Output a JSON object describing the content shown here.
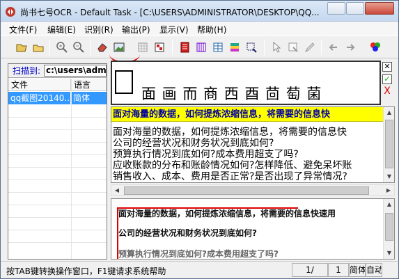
{
  "window": {
    "title": "尚书七号OCR - Default Task - [C:\\USERS\\ADMINISTRATOR\\DESKTOP\\QQ..."
  },
  "menu": [
    "文件(F)",
    "编辑(E)",
    "识别(R)",
    "输出(P)",
    "显示(V)",
    "帮助(H)"
  ],
  "toolbar": {
    "icons": [
      "open-folder-icon",
      "open-file-icon",
      "zoom-in-icon",
      "zoom-out-icon",
      "eraser-icon",
      "image-icon",
      "grid-icon",
      "layout-icon",
      "red-book-icon",
      "column-icon",
      "table-icon",
      "rainbow-icon",
      "select-icon",
      "pointer-icon",
      "crop-icon",
      "pen-icon",
      "back-arrow-icon",
      "forward-arrow-icon",
      "color-palette-icon"
    ]
  },
  "left_panel": {
    "scan_label": "扫描到:",
    "scan_path": "c:\\users\\admi",
    "columns": [
      "文件",
      "语言"
    ],
    "rows": [
      {
        "file": "qq截图20140...",
        "lang": "简体"
      }
    ]
  },
  "char_strip": {
    "chars": "面 画 而 商  西 酉 茴 萄  菌"
  },
  "side_icons": {
    "close": "✕",
    "check": "✓",
    "delete": "X"
  },
  "text": {
    "highlight": "面对海量的数据，如何提炼浓缩信息，将需要的信息快",
    "lines": [
      "面对海量的数据，如何提炼浓缩信息，将需要的信息快",
      "公司的经营状况和财务状况到底如何?",
      "预算执行情况到底如何?成本费用超支了吗?",
      "应收账款的分布和账龄情况如何?怎样降低、避免呆坏账",
      "销售收入、成本、费用是否正常?是否出现了异常情况?"
    ]
  },
  "image_preview": {
    "lines": [
      "面对海量的数据，如何提炼浓缩信息，将需要的信息快速用",
      "公司的经营状况和财务状况到底如何?",
      "预算执行情况到底如何?成本费用超支了吗?"
    ]
  },
  "status": {
    "message": "按TAB键转换操作窗口，F1键请求系统帮助",
    "page": "1/",
    "page_total": "1",
    "lang": "简体",
    "mode": "自动"
  }
}
